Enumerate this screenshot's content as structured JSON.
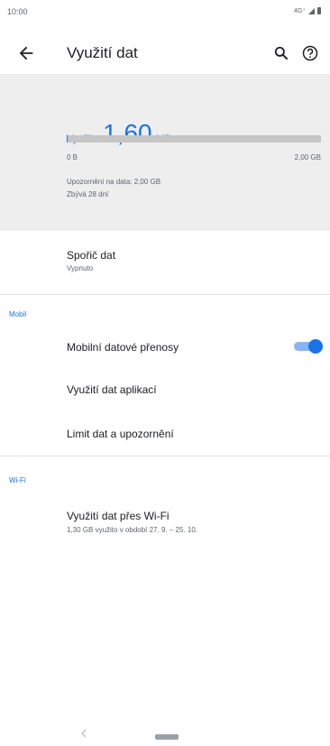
{
  "status_bar": {
    "time": "10:00",
    "signal": "4G⁺"
  },
  "app_bar": {
    "title": "Využití dat",
    "back_icon": "arrow-back-icon",
    "search_icon": "search-icon",
    "help_icon": "help-icon"
  },
  "summary": {
    "usage_label": "Využito",
    "usage_value": "1,60",
    "usage_unit": "MB",
    "progress_fraction": 0.0008,
    "range_min": "0 B",
    "range_max": "2,00 GB",
    "warning": "Upozornění na data: 2,00 GB",
    "remaining": "Zbývá 28 dní"
  },
  "data_saver": {
    "title": "Spořič dat",
    "subtitle": "Vypnuto"
  },
  "mobile": {
    "header": "Mobil",
    "mobile_data": {
      "label": "Mobilní datové přenosy",
      "enabled": true
    },
    "app_usage": "Využití dat aplikací",
    "limit_warning": "Limit dat a upozornění"
  },
  "wifi": {
    "header": "Wi-Fi",
    "title": "Využití dat přes Wi-Fi",
    "subtitle": "1,30 GB využito v období 27. 9. – 25. 10."
  },
  "colors": {
    "accent": "#1a73e8",
    "summary_bg": "#eeeeee",
    "toggle_track": "#8ab4f8"
  }
}
